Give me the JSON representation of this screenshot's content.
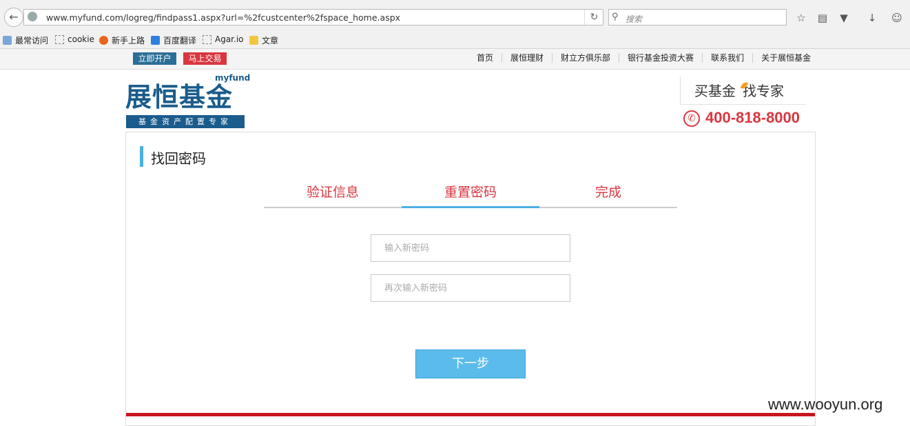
{
  "browser": {
    "url": "www.myfund.com/logreg/findpass1.aspx?url=%2fcustcenter%2fspace_home.aspx",
    "search_placeholder": "搜索",
    "bookmarks": [
      "最常访问",
      "cookie",
      "新手上路",
      "百度翻译",
      "Agar.io",
      "文章"
    ]
  },
  "site_top": {
    "open_account": "立即开户",
    "trade_now": "马上交易",
    "nav": [
      "首页",
      "展恒理财",
      "财立方俱乐部",
      "银行基金投资大赛",
      "联系我们",
      "关于展恒基金"
    ]
  },
  "header": {
    "logo_small": "myfund",
    "logo_main": "展恒基金",
    "logo_tagline": "基金资产配置专家",
    "slogan_part1": "买基金",
    "slogan_part2": "找专家",
    "phone": "400-818-8000"
  },
  "main": {
    "title": "找回密码",
    "steps": [
      "验证信息",
      "重置密码",
      "完成"
    ],
    "active_step": "重置密码",
    "new_password_placeholder": "输入新密码",
    "confirm_password_placeholder": "再次输入新密码",
    "next_button": "下一步"
  },
  "watermark": "www.wooyun.org",
  "colors": {
    "brand_blue": "#1a5c8c",
    "accent_red": "#d9363e",
    "step_blue": "#4ab0e4",
    "button_blue": "#5bbcec"
  }
}
